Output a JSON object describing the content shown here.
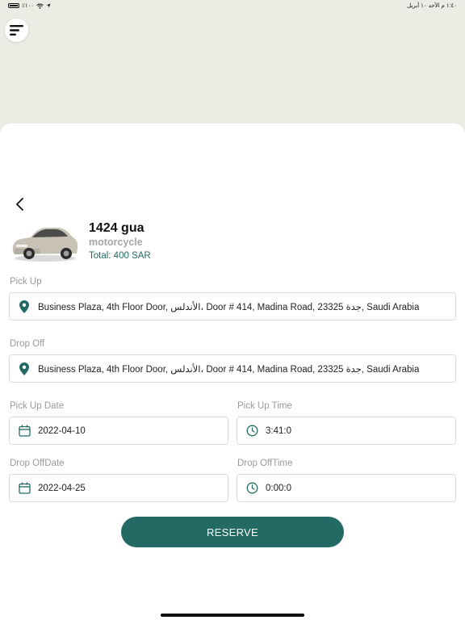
{
  "status_bar": {
    "left": "٪١٠٠",
    "right": "١:٤٠ م الأحد ١٠ أبريل"
  },
  "vehicle": {
    "title": "1424 gua",
    "type": "motorcycle",
    "total": "Total: 400 SAR"
  },
  "pickup": {
    "label": "Pick Up",
    "address": "Business Plaza, 4th Floor Door, الأندلس، Door # 414, Madina Road, 23325 جدة, Saudi Arabia"
  },
  "dropoff": {
    "label": "Drop Off",
    "address": "Business Plaza, 4th Floor Door, الأندلس، Door # 414, Madina Road, 23325 جدة, Saudi Arabia"
  },
  "pickup_date": {
    "label": "Pick Up Date",
    "value": "2022-04-10"
  },
  "pickup_time": {
    "label": "Pick Up Time",
    "value": "3:41:0"
  },
  "dropoff_date": {
    "label": "Drop OffDate",
    "value": "2022-04-25"
  },
  "dropoff_time": {
    "label": "Drop OffTime",
    "value": "0:00:0"
  },
  "reserve_label": "RESERVE",
  "colors": {
    "accent": "#226a63",
    "map_bg": "#ecebe4",
    "label_gray": "#9a9a9a"
  },
  "icons": [
    "menu-icon",
    "back-chevron-icon",
    "location-pin-icon",
    "calendar-icon",
    "clock-icon",
    "wifi-icon",
    "battery-icon"
  ]
}
